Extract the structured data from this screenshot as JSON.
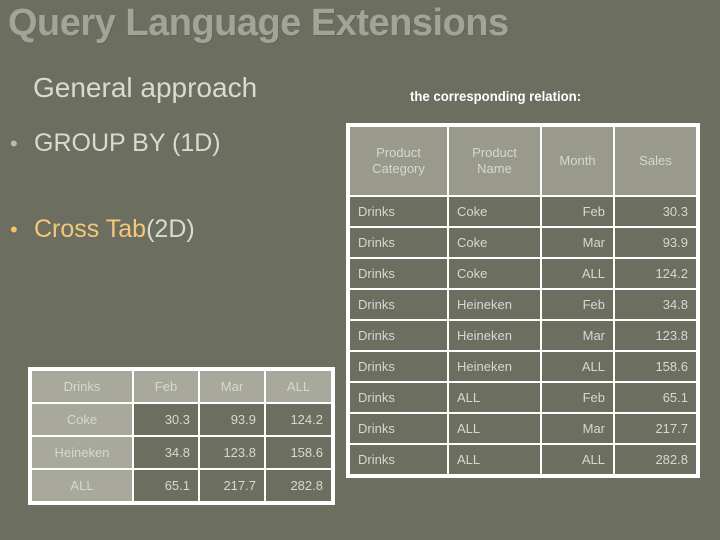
{
  "slide": {
    "title": "Query Language Extensions",
    "section_heading": "General approach",
    "relation_caption": "the corresponding relation:"
  },
  "bullets": [
    {
      "marker": "•",
      "text": "GROUP BY (1D)",
      "accent": false
    },
    {
      "marker": "•",
      "accent_text": "Cross Tab",
      "text": " (2D)",
      "accent": true
    }
  ],
  "colors": {
    "background": "#6c6e60",
    "title": "#a3a497",
    "body_text": "#d9dad2",
    "accent": "#f3c878",
    "table_border": "#ffffff",
    "header_cell": "#999a8c",
    "light_cell": "#a8a99c",
    "data_cell": "#6c6e60"
  },
  "crosstab_table": {
    "headers": [
      "Drinks",
      "Feb",
      "Mar",
      "ALL"
    ],
    "rows": [
      {
        "label": "Coke",
        "values": [
          "30.3",
          "93.9",
          "124.2"
        ]
      },
      {
        "label": "Heineken",
        "values": [
          "34.8",
          "123.8",
          "158.6"
        ]
      },
      {
        "label": "ALL",
        "values": [
          "65.1",
          "217.7",
          "282.8"
        ]
      }
    ]
  },
  "relation_table": {
    "headers": [
      "Product Category",
      "Product Name",
      "Month",
      "Sales"
    ],
    "header_lines": [
      [
        "Product",
        "Category"
      ],
      [
        "Product",
        "Name"
      ],
      [
        "Month"
      ],
      [
        "Sales"
      ]
    ],
    "rows": [
      {
        "category": "Drinks",
        "name": "Coke",
        "month": "Feb",
        "sales": "30.3"
      },
      {
        "category": "Drinks",
        "name": "Coke",
        "month": "Mar",
        "sales": "93.9"
      },
      {
        "category": "Drinks",
        "name": "Coke",
        "month": "ALL",
        "sales": "124.2"
      },
      {
        "category": "Drinks",
        "name": "Heineken",
        "month": "Feb",
        "sales": "34.8"
      },
      {
        "category": "Drinks",
        "name": "Heineken",
        "month": "Mar",
        "sales": "123.8"
      },
      {
        "category": "Drinks",
        "name": "Heineken",
        "month": "ALL",
        "sales": "158.6"
      },
      {
        "category": "Drinks",
        "name": "ALL",
        "month": "Feb",
        "sales": "65.1"
      },
      {
        "category": "Drinks",
        "name": "ALL",
        "month": "Mar",
        "sales": "217.7"
      },
      {
        "category": "Drinks",
        "name": "ALL",
        "month": "ALL",
        "sales": "282.8"
      }
    ]
  }
}
